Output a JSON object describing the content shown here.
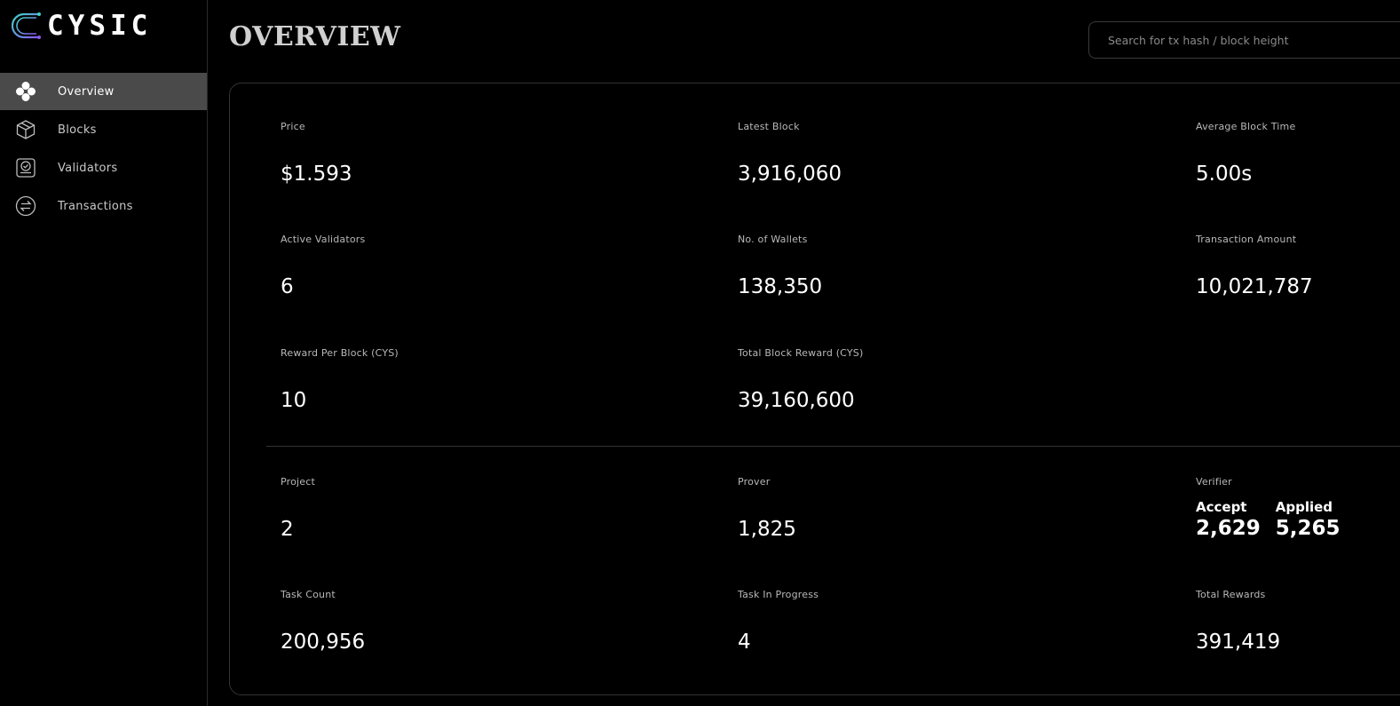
{
  "brand": {
    "name": "CYSIC"
  },
  "sidebar": {
    "items": [
      {
        "label": "Overview",
        "icon": "overview-icon",
        "active": true
      },
      {
        "label": "Blocks",
        "icon": "cube-icon",
        "active": false
      },
      {
        "label": "Validators",
        "icon": "validator-check-icon",
        "active": false
      },
      {
        "label": "Transactions",
        "icon": "swap-arrows-icon",
        "active": false
      }
    ]
  },
  "header": {
    "title": "OVERVIEW",
    "search_placeholder": "Search for tx hash / block height"
  },
  "stats": {
    "price": {
      "label": "Price",
      "value": "$1.593"
    },
    "latest_block": {
      "label": "Latest Block",
      "value": "3,916,060"
    },
    "avg_block_time": {
      "label": "Average Block Time",
      "value": "5.00s"
    },
    "active_validators": {
      "label": "Active Validators",
      "value": "6"
    },
    "wallets": {
      "label": "No. of Wallets",
      "value": "138,350"
    },
    "tx_amount": {
      "label": "Transaction Amount",
      "value": "10,021,787"
    },
    "reward_per_block": {
      "label": "Reward Per Block (CYS)",
      "value": "10"
    },
    "total_block_reward": {
      "label": "Total Block Reward (CYS)",
      "value": "39,160,600"
    },
    "project": {
      "label": "Project",
      "value": "2"
    },
    "prover": {
      "label": "Prover",
      "value": "1,825"
    },
    "verifier": {
      "label": "Verifier",
      "accept_label": "Accept",
      "accept_value": "2,629",
      "applied_label": "Applied",
      "applied_value": "5,265"
    },
    "task_count": {
      "label": "Task Count",
      "value": "200,956"
    },
    "task_in_progress": {
      "label": "Task In Progress",
      "value": "4"
    },
    "total_rewards": {
      "label": "Total Rewards",
      "value": "391,419"
    }
  },
  "colors": {
    "background": "#000000",
    "active_nav": "#4a4a4a",
    "border": "#333333",
    "logo_gradient": [
      "#3fd3c8",
      "#8a5cf0"
    ]
  }
}
